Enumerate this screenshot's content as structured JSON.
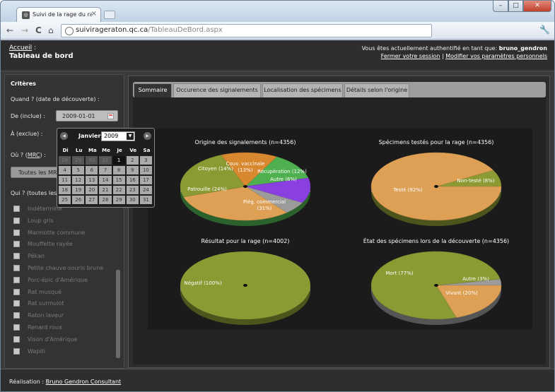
{
  "browser": {
    "tab_title": "Suivi de la rage du raton l...",
    "tab_close": "×",
    "url_host": "suivirageraton.qc.ca",
    "url_path": "/TableauDeBord.aspx",
    "nav": {
      "back": "←",
      "forward": "→",
      "reload": "C",
      "home": "⌂"
    }
  },
  "header": {
    "breadcrumb": "Accueil",
    "breadcrumb_sep": " :",
    "page_title": "Tableau de bord",
    "auth_prefix": "Vous êtes actuellement authentifié en tant que: ",
    "username": "bruno_gendron",
    "logout": "Fermer votre session",
    "sep": " | ",
    "settings": "Modifier vos paramètres personnels"
  },
  "criteria": {
    "title": "Critères",
    "when": "Quand ? (date de découverte) :",
    "from_label": "De (inclue) :",
    "from_value": "2009-01-01",
    "to_label": "À (exclue) :",
    "where_prefix": "Où ? (",
    "where_abbr": "MRC",
    "where_suffix": ") :",
    "mrc_value": "Toutes les MRC",
    "who": "Qui ? (toutes les espèces)",
    "species": [
      "Indéterminé",
      "Loup gris",
      "Marmotte commune",
      "Mouffette rayée",
      "Pékan",
      "Petite chauve-souris brune",
      "Porc-épic d'Amérique",
      "Rat musqué",
      "Rat surmulot",
      "Raton laveur",
      "Renard roux",
      "Vison d'Amérique",
      "Wapiti"
    ]
  },
  "calendar": {
    "month": "Janvier",
    "year": "2009",
    "prev": "◀",
    "next": "▶",
    "weekdays": [
      "Di",
      "Lu",
      "Ma",
      "Me",
      "Je",
      "Ve",
      "Sa"
    ],
    "weeks": [
      [
        {
          "d": "28",
          "o": true
        },
        {
          "d": "29",
          "o": true
        },
        {
          "d": "30",
          "o": true
        },
        {
          "d": "31",
          "o": true
        },
        {
          "d": "1",
          "s": true
        },
        {
          "d": "2"
        },
        {
          "d": "3"
        }
      ],
      [
        {
          "d": "4"
        },
        {
          "d": "5"
        },
        {
          "d": "6"
        },
        {
          "d": "7"
        },
        {
          "d": "8"
        },
        {
          "d": "9"
        },
        {
          "d": "10"
        }
      ],
      [
        {
          "d": "11"
        },
        {
          "d": "12"
        },
        {
          "d": "13"
        },
        {
          "d": "14"
        },
        {
          "d": "15"
        },
        {
          "d": "16"
        },
        {
          "d": "17"
        }
      ],
      [
        {
          "d": "18"
        },
        {
          "d": "19"
        },
        {
          "d": "20"
        },
        {
          "d": "21"
        },
        {
          "d": "22"
        },
        {
          "d": "23"
        },
        {
          "d": "24"
        }
      ],
      [
        {
          "d": "25"
        },
        {
          "d": "26"
        },
        {
          "d": "27"
        },
        {
          "d": "28"
        },
        {
          "d": "29"
        },
        {
          "d": "30"
        },
        {
          "d": "31"
        }
      ]
    ]
  },
  "tabs": [
    "Sommaire",
    "Occurence des signalements",
    "Localisation des spécimens",
    "Détails selon l'origine"
  ],
  "footer": {
    "prefix": "Réalisation : ",
    "link": "Bruno Gendron Consultant"
  },
  "chart_data": [
    {
      "type": "pie",
      "title": "Origine des signalements (n=4356)",
      "labels": [
        "Couv. vaccinale (13%)",
        "Récupération (12%)",
        "Autre (6%)",
        "Piég. commercial (31%)",
        "Patrouille (24%)",
        "Citoyen (14%)"
      ],
      "values": [
        13,
        12,
        6,
        31,
        24,
        14
      ],
      "colors": [
        "#4fb04f",
        "#8a3fe0",
        "#9b9b9b",
        "#dda055",
        "#8c9a33",
        "#d8882f"
      ]
    },
    {
      "type": "pie",
      "title": "Spécimens testés pour la rage (n=4356)",
      "labels": [
        "Non-testé (8%)",
        "Testé (92%)"
      ],
      "values": [
        8,
        92
      ],
      "colors": [
        "#8c9a33",
        "#dda055"
      ]
    },
    {
      "type": "pie",
      "title": "Résultat pour la rage (n=4002)",
      "labels": [
        "Négatif (100%)"
      ],
      "values": [
        100
      ],
      "colors": [
        "#8c9a33"
      ]
    },
    {
      "type": "pie",
      "title": "État des spécimens lors de la découverte (n=4356)",
      "labels": [
        "Autre (3%)",
        "Vivant (20%)",
        "Mort (77%)"
      ],
      "values": [
        3,
        20,
        77
      ],
      "colors": [
        "#9b9b9b",
        "#dda055",
        "#8c9a33"
      ]
    }
  ]
}
